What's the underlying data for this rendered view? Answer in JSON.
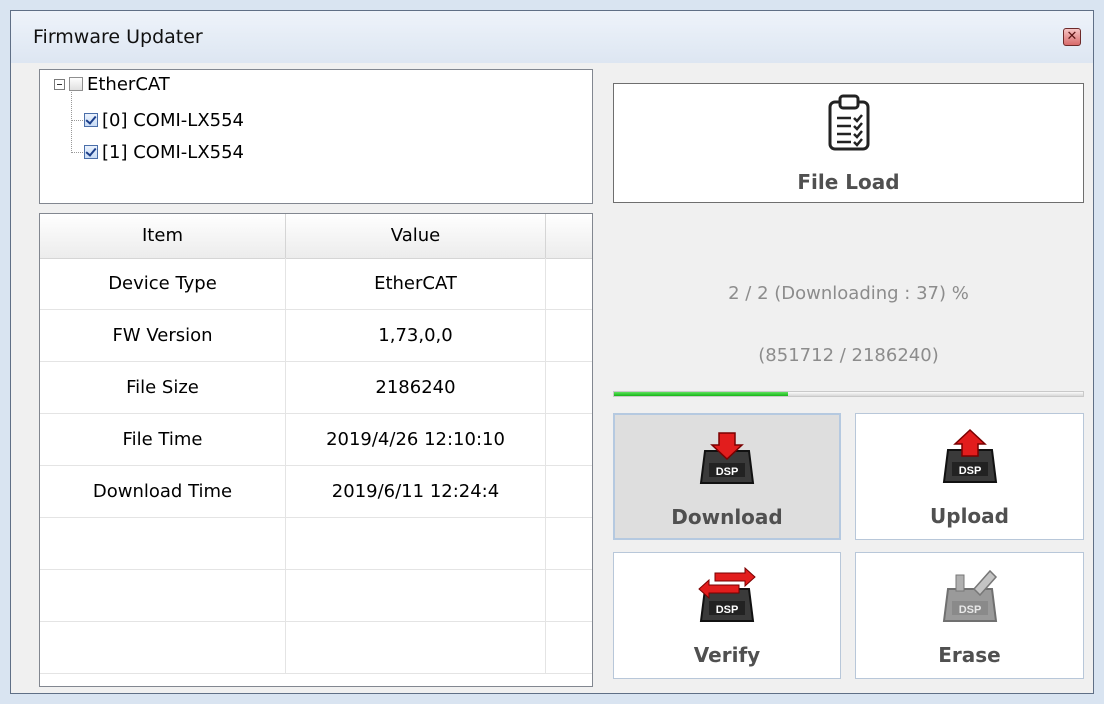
{
  "window": {
    "title": "Firmware Updater",
    "close_symbol": "✕"
  },
  "tree": {
    "root": {
      "label": "EtherCAT",
      "checked": false
    },
    "children": [
      {
        "label": "[0] COMI-LX554",
        "checked": true
      },
      {
        "label": "[1] COMI-LX554",
        "checked": true
      }
    ]
  },
  "table": {
    "headers": [
      "Item",
      "Value"
    ],
    "rows": [
      [
        "Device Type",
        "EtherCAT"
      ],
      [
        "FW Version",
        "1,73,0,0"
      ],
      [
        "File Size",
        "2186240"
      ],
      [
        "File Time",
        "2019/4/26 12:10:10"
      ],
      [
        "Download Time",
        "2019/6/11 12:24:4"
      ],
      [
        "",
        ""
      ],
      [
        "",
        ""
      ],
      [
        "",
        ""
      ]
    ]
  },
  "file_load": {
    "label": "File Load",
    "icon": "clipboard-checklist-icon"
  },
  "progress": {
    "status_text": "2 / 2 (Downloading : 37) %",
    "bytes_text": "(851712 / 2186240)",
    "fraction": 0.37,
    "fill_color": "#22c022"
  },
  "actions": {
    "download": {
      "label": "Download",
      "icon": "dsp-download-icon",
      "pressed": true
    },
    "upload": {
      "label": "Upload",
      "icon": "dsp-upload-icon"
    },
    "verify": {
      "label": "Verify",
      "icon": "dsp-verify-icon"
    },
    "erase": {
      "label": "Erase",
      "icon": "dsp-erase-icon",
      "disabled": true
    }
  }
}
